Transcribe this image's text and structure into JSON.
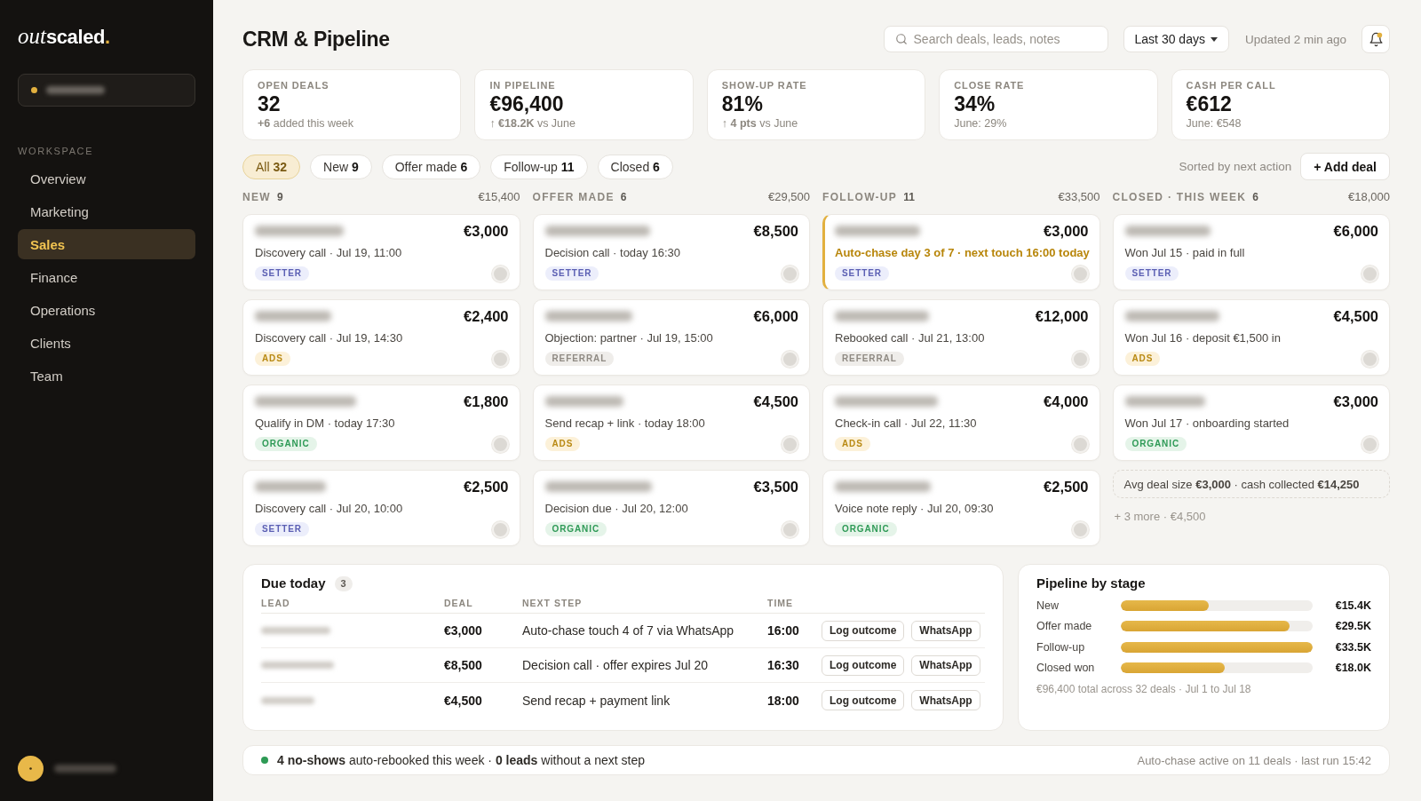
{
  "sidebar": {
    "logo": {
      "italic": "out",
      "bold": "scaled",
      "dot": "."
    },
    "section": "WORKSPACE",
    "items": [
      {
        "label": "Overview",
        "selected": false
      },
      {
        "label": "Marketing",
        "selected": false
      },
      {
        "label": "Sales",
        "selected": true
      },
      {
        "label": "Finance",
        "selected": false
      },
      {
        "label": "Operations",
        "selected": false
      },
      {
        "label": "Clients",
        "selected": false
      },
      {
        "label": "Team",
        "selected": false
      }
    ]
  },
  "header": {
    "title": "CRM & Pipeline",
    "search": {
      "placeholder": "Search deals, leads, notes"
    },
    "date_range": "Last 30 days",
    "updated": "Updated 2 min ago"
  },
  "kpis": [
    {
      "label": "OPEN DEALS",
      "value": "32",
      "note": "**+6** added this week"
    },
    {
      "label": "IN PIPELINE",
      "value": "€96,400",
      "note": "**↑ €18.2K** vs June"
    },
    {
      "label": "SHOW-UP RATE",
      "value": "81%",
      "note": "**↑ 4 pts** vs June"
    },
    {
      "label": "CLOSE RATE",
      "value": "34%",
      "note": "June: 29%"
    },
    {
      "label": "CASH PER CALL",
      "value": "€612",
      "note": "June: €548"
    }
  ],
  "filters": [
    {
      "label": "All",
      "count": "32",
      "selected": true
    },
    {
      "label": "New",
      "count": "9",
      "selected": false
    },
    {
      "label": "Offer made",
      "count": "6",
      "selected": false
    },
    {
      "label": "Follow-up",
      "count": "11",
      "selected": false
    },
    {
      "label": "Closed",
      "count": "6",
      "selected": false
    }
  ],
  "sort_label": "Sorted by next action",
  "add_button": "+ Add deal",
  "columns": [
    {
      "title": "NEW",
      "count": "9",
      "total": "€15,400",
      "deals": [
        {
          "amount": "€3,000",
          "next": "Discovery call · Jul 19, 11:00",
          "tag": {
            "label": "SETTER",
            "kind": "setter"
          },
          "highlighted": false
        },
        {
          "amount": "€2,400",
          "next": "Discovery call · Jul 19, 14:30",
          "tag": {
            "label": "ADS",
            "kind": "ads"
          },
          "highlighted": false
        },
        {
          "amount": "€1,800",
          "next": "Qualify in DM · today 17:30",
          "tag": {
            "label": "ORGANIC",
            "kind": "organic"
          },
          "highlighted": false
        },
        {
          "amount": "€2,500",
          "next": "Discovery call · Jul 20, 10:00",
          "tag": {
            "label": "SETTER",
            "kind": "setter"
          },
          "highlighted": false
        }
      ]
    },
    {
      "title": "OFFER MADE",
      "count": "6",
      "total": "€29,500",
      "deals": [
        {
          "amount": "€8,500",
          "next": "Decision call · today 16:30",
          "tag": {
            "label": "SETTER",
            "kind": "setter"
          },
          "highlighted": false
        },
        {
          "amount": "€6,000",
          "next": "Objection: partner · Jul 19, 15:00",
          "tag": {
            "label": "REFERRAL",
            "kind": "referral"
          },
          "highlighted": false
        },
        {
          "amount": "€4,500",
          "next": "Send recap + link · today 18:00",
          "tag": {
            "label": "ADS",
            "kind": "ads"
          },
          "highlighted": false
        },
        {
          "amount": "€3,500",
          "next": "Decision due · Jul 20, 12:00",
          "tag": {
            "label": "ORGANIC",
            "kind": "organic"
          },
          "highlighted": false
        }
      ]
    },
    {
      "title": "FOLLOW-UP",
      "count": "11",
      "total": "€33,500",
      "deals": [
        {
          "amount": "€3,000",
          "next": "Auto-chase day 3 of 7 · next touch 16:00 today",
          "tag": {
            "label": "SETTER",
            "kind": "setter"
          },
          "highlighted": true
        },
        {
          "amount": "€12,000",
          "next": "Rebooked call · Jul 21, 13:00",
          "tag": {
            "label": "REFERRAL",
            "kind": "referral"
          },
          "highlighted": false
        },
        {
          "amount": "€4,000",
          "next": "Check-in call · Jul 22, 11:30",
          "tag": {
            "label": "ADS",
            "kind": "ads"
          },
          "highlighted": false
        },
        {
          "amount": "€2,500",
          "next": "Voice note reply · Jul 20, 09:30",
          "tag": {
            "label": "ORGANIC",
            "kind": "organic"
          },
          "highlighted": false
        }
      ]
    },
    {
      "title": "CLOSED · THIS WEEK",
      "count": "6",
      "total": "€18,000",
      "deals": [
        {
          "amount": "€6,000",
          "next": "Won Jul 15 · paid in full",
          "tag": {
            "label": "SETTER",
            "kind": "setter"
          },
          "highlighted": false
        },
        {
          "amount": "€4,500",
          "next": "Won Jul 16 · deposit €1,500 in",
          "tag": {
            "label": "ADS",
            "kind": "ads"
          },
          "highlighted": false
        },
        {
          "amount": "€3,000",
          "next": "Won Jul 17 · onboarding started",
          "tag": {
            "label": "ORGANIC",
            "kind": "organic"
          },
          "highlighted": false
        }
      ],
      "summary": "Avg deal size **€3,000** · cash collected **€14,250**",
      "more": "+ 3 more · €4,500"
    }
  ],
  "due_today": {
    "title": "Due today",
    "count": "3",
    "columns": [
      "LEAD",
      "DEAL",
      "NEXT STEP",
      "TIME"
    ],
    "rows": [
      {
        "deal": "€3,000",
        "next_step": "Auto-chase touch 4 of 7 via WhatsApp",
        "time": "16:00",
        "actions": [
          "Log outcome",
          "WhatsApp"
        ]
      },
      {
        "deal": "€8,500",
        "next_step": "Decision call · offer expires Jul 20",
        "time": "16:30",
        "actions": [
          "Log outcome",
          "WhatsApp"
        ]
      },
      {
        "deal": "€4,500",
        "next_step": "Send recap + payment link",
        "time": "18:00",
        "actions": [
          "Log outcome",
          "WhatsApp"
        ]
      }
    ]
  },
  "pipeline": {
    "title": "Pipeline by stage",
    "stages": [
      {
        "label": "New",
        "level": 0.46,
        "value": "€15.4K"
      },
      {
        "label": "Offer made",
        "level": 0.88,
        "value": "€29.5K"
      },
      {
        "label": "Follow-up",
        "level": 1,
        "value": "€33.5K"
      },
      {
        "label": "Closed won",
        "level": 0.54,
        "value": "€18.0K"
      }
    ],
    "footnote": "€96,400 total across 32 deals · Jul 1 to Jul 18"
  },
  "status_bar": {
    "summary": "**4 no-shows** auto-rebooked this week · **0 leads** without a next step",
    "auto_chase": "Auto-chase active on 11 deals · last run 15:42"
  }
}
